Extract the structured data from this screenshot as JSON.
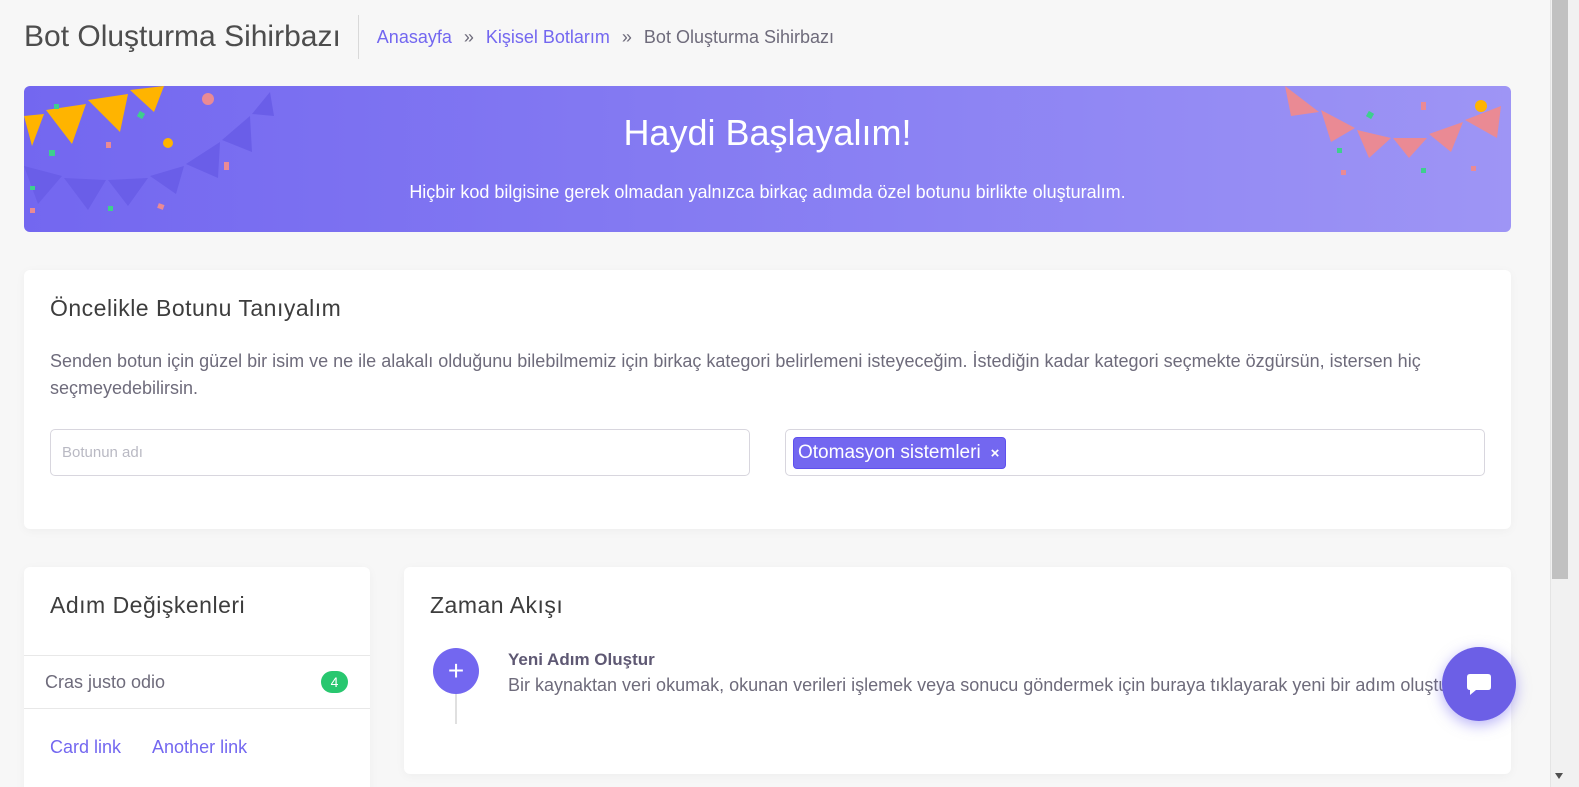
{
  "header": {
    "title": "Bot Oluşturma Sihirbazı",
    "breadcrumb": [
      {
        "label": "Anasayfa"
      },
      {
        "label": "Kişisel Botlarım"
      },
      {
        "label": "Bot Oluşturma Sihirbazı"
      }
    ],
    "separator": "»"
  },
  "hero": {
    "title": "Haydi Başlayalım!",
    "subtitle": "Hiçbir kod bilgisine gerek olmadan yalnızca birkaç adımda özel botunu birlikte oluşturalım."
  },
  "intro": {
    "title": "Öncelikle Botunu Tanıyalım",
    "description": "Senden botun için güzel bir isim ve ne ile alakalı olduğunu bilebilmemiz için birkaç kategori belirlemeni isteyeceğim. İstediğin kadar kategori seçmekte özgürsün, istersen hiç seçmeyedebilirsin.",
    "name_input": {
      "value": "",
      "placeholder": "Botunun adı"
    },
    "categories": [
      {
        "label": "Otomasyon sistemleri",
        "remove": "×"
      }
    ]
  },
  "variables": {
    "title": "Adım Değişkenleri",
    "item": {
      "label": "Cras justo odio",
      "count": "4"
    },
    "links": [
      "Card link",
      "Another link"
    ]
  },
  "timeline": {
    "title": "Zaman Akışı",
    "step": {
      "icon": "plus-icon",
      "symbol": "+",
      "title": "Yeni Adım Oluştur",
      "description": "Bir kaynaktan veri okumak, okunan verileri işlemek veya sonucu göndermek için buraya tıklayarak yeni bir adım oluştur."
    }
  },
  "chat": {
    "icon": "chat-bubble-icon"
  },
  "colors": {
    "primary": "#7367f0",
    "success": "#28c76f",
    "pennant_yellow": "#ffb400",
    "pennant_pink": "#ea8a94"
  }
}
